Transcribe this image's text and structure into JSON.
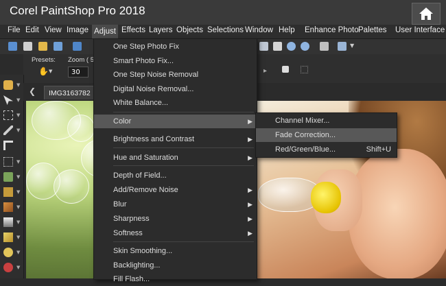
{
  "app": {
    "title": "Corel PaintShop Pro 2018"
  },
  "menubar": {
    "items": [
      "File",
      "Edit",
      "View",
      "Image",
      "Adjust",
      "Effects",
      "Layers",
      "Objects",
      "Selections",
      "Window",
      "Help",
      "Enhance Photo",
      "Palettes",
      "User Interface"
    ],
    "active": "Adjust"
  },
  "options": {
    "presets_label": "Presets:",
    "zoom_label": "Zoom ( 5",
    "zoom_value": "30"
  },
  "document": {
    "tab": "IMG3163782"
  },
  "adjust_menu": {
    "items": [
      {
        "label": "One Step Photo Fix",
        "submenu": false
      },
      {
        "label": "Smart Photo Fix...",
        "submenu": false
      },
      {
        "label": "One Step Noise Removal",
        "submenu": false
      },
      {
        "label": "Digital Noise Removal...",
        "submenu": false
      },
      {
        "label": "White Balance...",
        "submenu": false
      },
      {
        "label": "Color",
        "submenu": true,
        "highlighted": true
      },
      {
        "label": "Brightness and Contrast",
        "submenu": true
      },
      {
        "label": "Hue and Saturation",
        "submenu": true
      },
      {
        "label": "Depth of Field...",
        "submenu": false
      },
      {
        "label": "Add/Remove Noise",
        "submenu": true
      },
      {
        "label": "Blur",
        "submenu": true
      },
      {
        "label": "Sharpness",
        "submenu": true
      },
      {
        "label": "Softness",
        "submenu": true
      },
      {
        "label": "Skin Smoothing...",
        "submenu": false
      },
      {
        "label": "Backlighting...",
        "submenu": false
      },
      {
        "label": "Fill Flash...",
        "submenu": false
      }
    ]
  },
  "color_submenu": {
    "items": [
      {
        "label": "Channel Mixer...",
        "shortcut": ""
      },
      {
        "label": "Fade Correction...",
        "shortcut": "",
        "highlighted": true
      },
      {
        "label": "Red/Green/Blue...",
        "shortcut": "Shift+U"
      }
    ]
  },
  "colors": {
    "menu_bg": "#2c2c2c",
    "highlight": "#585858",
    "title_bg": "#3a3a3a"
  }
}
